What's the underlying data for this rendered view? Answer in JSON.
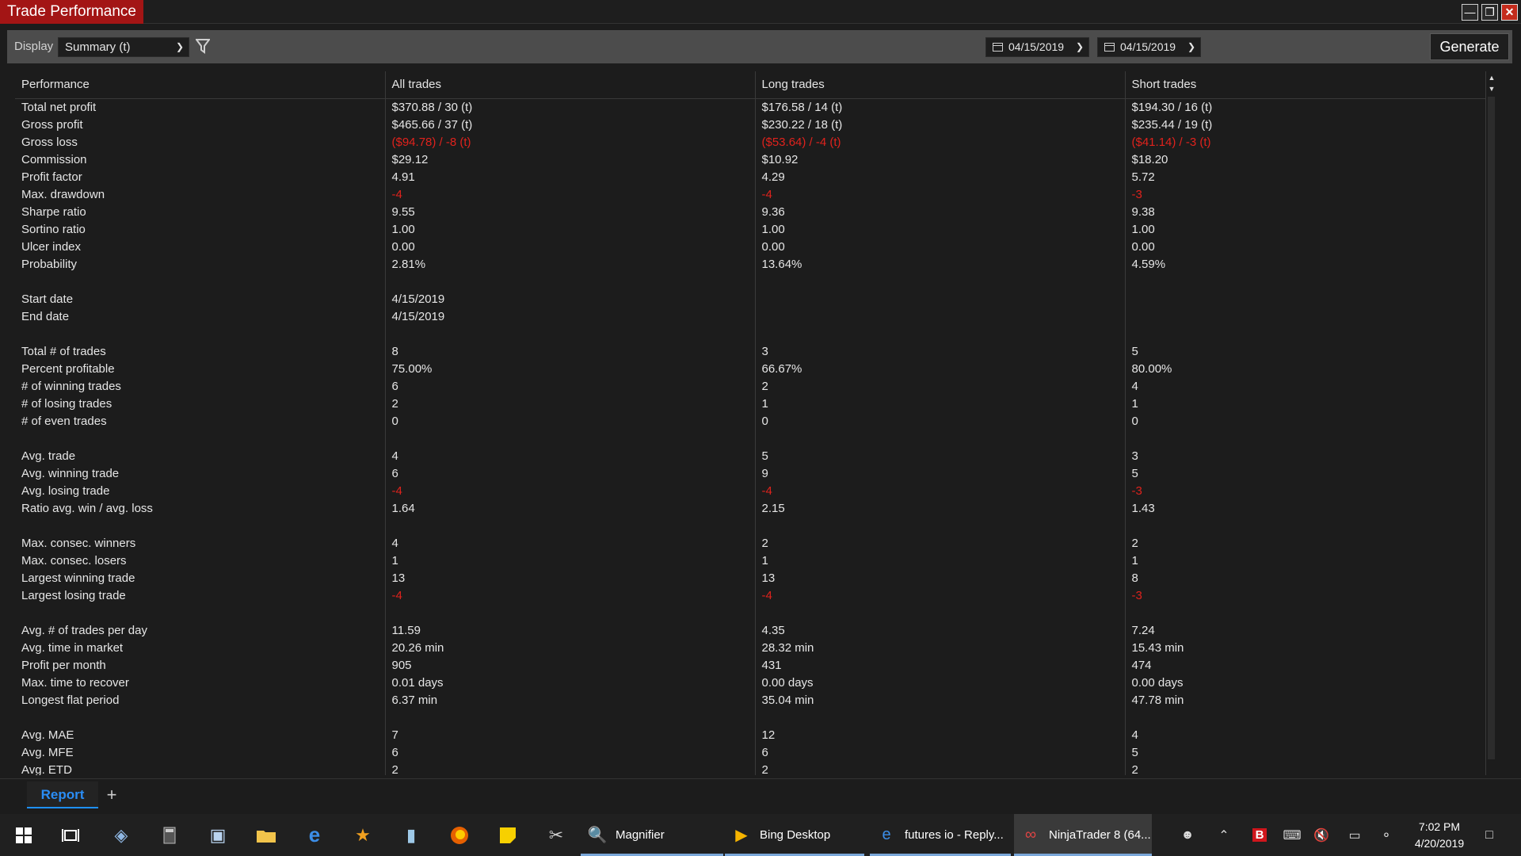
{
  "window": {
    "title": "Trade Performance"
  },
  "toolbar": {
    "display_label": "Display",
    "display_value": "Summary (t)",
    "date_from": "04/15/2019",
    "date_to": "04/15/2019",
    "generate_label": "Generate"
  },
  "columns": [
    "Performance",
    "All trades",
    "Long trades",
    "Short trades"
  ],
  "rows": [
    {
      "label": "Total net profit",
      "all": "$370.88 / 30 (t)",
      "long": "$176.58 / 14 (t)",
      "short": "$194.30 / 16 (t)",
      "neg": false
    },
    {
      "label": "Gross profit",
      "all": "$465.66 / 37 (t)",
      "long": "$230.22 / 18 (t)",
      "short": "$235.44 / 19 (t)",
      "neg": false
    },
    {
      "label": "Gross loss",
      "all": "($94.78) / -8 (t)",
      "long": "($53.64) / -4 (t)",
      "short": "($41.14) / -3 (t)",
      "neg": true
    },
    {
      "label": "Commission",
      "all": "$29.12",
      "long": "$10.92",
      "short": "$18.20",
      "neg": false
    },
    {
      "label": "Profit factor",
      "all": "4.91",
      "long": "4.29",
      "short": "5.72",
      "neg": false
    },
    {
      "label": "Max. drawdown",
      "all": "-4",
      "long": "-4",
      "short": "-3",
      "neg": true
    },
    {
      "label": "Sharpe ratio",
      "all": "9.55",
      "long": "9.36",
      "short": "9.38",
      "neg": false
    },
    {
      "label": "Sortino ratio",
      "all": "1.00",
      "long": "1.00",
      "short": "1.00",
      "neg": false
    },
    {
      "label": "Ulcer index",
      "all": "0.00",
      "long": "0.00",
      "short": "0.00",
      "neg": false
    },
    {
      "label": "Probability",
      "all": "2.81%",
      "long": "13.64%",
      "short": "4.59%",
      "neg": false
    },
    {
      "label": "",
      "all": "",
      "long": "",
      "short": "",
      "neg": false
    },
    {
      "label": "Start date",
      "all": "4/15/2019",
      "long": "",
      "short": "",
      "neg": false
    },
    {
      "label": "End date",
      "all": "4/15/2019",
      "long": "",
      "short": "",
      "neg": false
    },
    {
      "label": "",
      "all": "",
      "long": "",
      "short": "",
      "neg": false
    },
    {
      "label": "Total # of trades",
      "all": "8",
      "long": "3",
      "short": "5",
      "neg": false
    },
    {
      "label": "Percent profitable",
      "all": "75.00%",
      "long": "66.67%",
      "short": "80.00%",
      "neg": false
    },
    {
      "label": "# of winning trades",
      "all": "6",
      "long": "2",
      "short": "4",
      "neg": false
    },
    {
      "label": "# of losing trades",
      "all": "2",
      "long": "1",
      "short": "1",
      "neg": false
    },
    {
      "label": "# of even trades",
      "all": "0",
      "long": "0",
      "short": "0",
      "neg": false
    },
    {
      "label": "",
      "all": "",
      "long": "",
      "short": "",
      "neg": false
    },
    {
      "label": "Avg. trade",
      "all": "4",
      "long": "5",
      "short": "3",
      "neg": false
    },
    {
      "label": "Avg. winning trade",
      "all": "6",
      "long": "9",
      "short": "5",
      "neg": false
    },
    {
      "label": "Avg. losing trade",
      "all": "-4",
      "long": "-4",
      "short": "-3",
      "neg": true
    },
    {
      "label": "Ratio avg. win / avg. loss",
      "all": "1.64",
      "long": "2.15",
      "short": "1.43",
      "neg": false
    },
    {
      "label": "",
      "all": "",
      "long": "",
      "short": "",
      "neg": false
    },
    {
      "label": "Max. consec. winners",
      "all": "4",
      "long": "2",
      "short": "2",
      "neg": false
    },
    {
      "label": "Max. consec. losers",
      "all": "1",
      "long": "1",
      "short": "1",
      "neg": false
    },
    {
      "label": "Largest winning trade",
      "all": "13",
      "long": "13",
      "short": "8",
      "neg": false
    },
    {
      "label": "Largest losing trade",
      "all": "-4",
      "long": "-4",
      "short": "-3",
      "neg": true
    },
    {
      "label": "",
      "all": "",
      "long": "",
      "short": "",
      "neg": false
    },
    {
      "label": "Avg. # of trades per day",
      "all": "11.59",
      "long": "4.35",
      "short": "7.24",
      "neg": false
    },
    {
      "label": "Avg. time in market",
      "all": "20.26 min",
      "long": "28.32 min",
      "short": "15.43 min",
      "neg": false
    },
    {
      "label": "Profit per month",
      "all": "905",
      "long": "431",
      "short": "474",
      "neg": false
    },
    {
      "label": "Max. time to recover",
      "all": "0.01 days",
      "long": "0.00 days",
      "short": "0.00 days",
      "neg": false
    },
    {
      "label": "Longest flat period",
      "all": "6.37 min",
      "long": "35.04 min",
      "short": "47.78 min",
      "neg": false
    },
    {
      "label": "",
      "all": "",
      "long": "",
      "short": "",
      "neg": false
    },
    {
      "label": "Avg. MAE",
      "all": "7",
      "long": "12",
      "short": "4",
      "neg": false
    },
    {
      "label": "Avg. MFE",
      "all": "6",
      "long": "6",
      "short": "5",
      "neg": false
    },
    {
      "label": "Avg. ETD",
      "all": "2",
      "long": "2",
      "short": "2",
      "neg": false
    }
  ],
  "tabs": {
    "report_label": "Report",
    "add_label": "+"
  },
  "taskbar": {
    "apps": [
      {
        "name": "magnifier",
        "label": "Magnifier",
        "icon": "magnifier-icon"
      },
      {
        "name": "bing-desktop",
        "label": "Bing Desktop",
        "icon": "bing-icon"
      },
      {
        "name": "futures-io",
        "label": "futures io - Reply...",
        "icon": "edge-icon"
      },
      {
        "name": "ninjatrader",
        "label": "NinjaTrader 8 (64...",
        "icon": "ninjatrader-icon"
      }
    ],
    "time": "7:02 PM",
    "date": "4/20/2019"
  }
}
